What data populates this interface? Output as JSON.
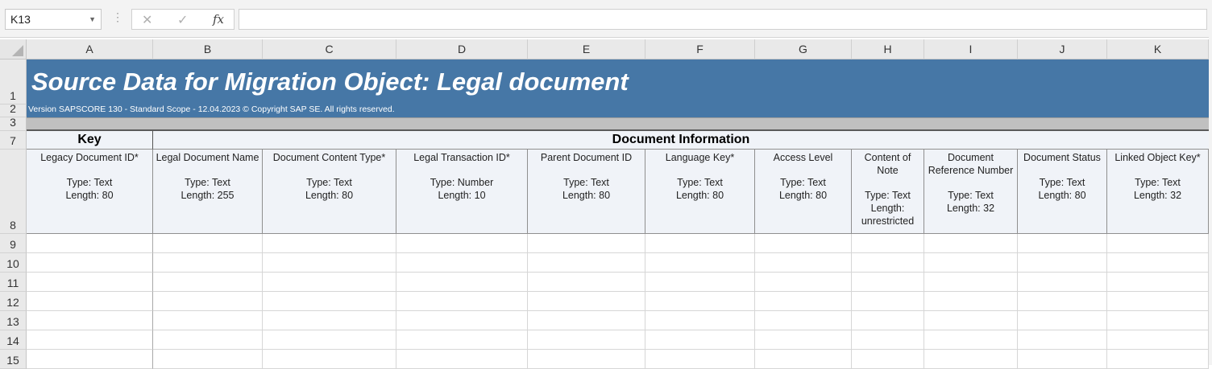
{
  "formula_bar": {
    "name_box": "K13",
    "cancel_icon": "close-icon",
    "enter_icon": "check-icon",
    "function_label": "fx",
    "formula": ""
  },
  "columns": [
    "A",
    "B",
    "C",
    "D",
    "E",
    "F",
    "G",
    "H",
    "I",
    "J",
    "K"
  ],
  "rows": [
    "1",
    "2",
    "3",
    "7",
    "8",
    "9",
    "10",
    "11",
    "12",
    "13",
    "14",
    "15"
  ],
  "sheet": {
    "title": "Source Data for Migration Object:  Legal document",
    "version": "Version SAPSCORE 130  - Standard Scope - 12.04.2023 © Copyright SAP SE. All rights reserved.",
    "groups": {
      "key": "Key",
      "document_information": "Document Information"
    },
    "headers": [
      {
        "name": "Legacy Document ID*",
        "type": "Type: Text",
        "length": "Length: 80"
      },
      {
        "name": "Legal Document Name",
        "type": "Type: Text",
        "length": "Length: 255"
      },
      {
        "name": "Document Content Type*",
        "type": "Type: Text",
        "length": "Length: 80"
      },
      {
        "name": "Legal Transaction ID*",
        "type": "Type: Number",
        "length": "Length: 10"
      },
      {
        "name": "Parent Document ID",
        "type": "Type: Text",
        "length": "Length: 80"
      },
      {
        "name": "Language Key*",
        "type": "Type: Text",
        "length": "Length: 80"
      },
      {
        "name": "Access Level",
        "type": "Type: Text",
        "length": "Length: 80"
      },
      {
        "name": "Content of Note",
        "type": "Type: Text",
        "length": "Length: unrestricted"
      },
      {
        "name": "Document Reference Number",
        "type": "Type: Text",
        "length": "Length: 32"
      },
      {
        "name": "Document Status",
        "type": "Type: Text",
        "length": "Length: 80"
      },
      {
        "name": "Linked Object Key*",
        "type": "Type: Text",
        "length": "Length: 32"
      }
    ]
  },
  "colors": {
    "title_band": "#4677a6",
    "header_fill": "#f0f3f8",
    "separator_band": "#c0c0c0"
  }
}
